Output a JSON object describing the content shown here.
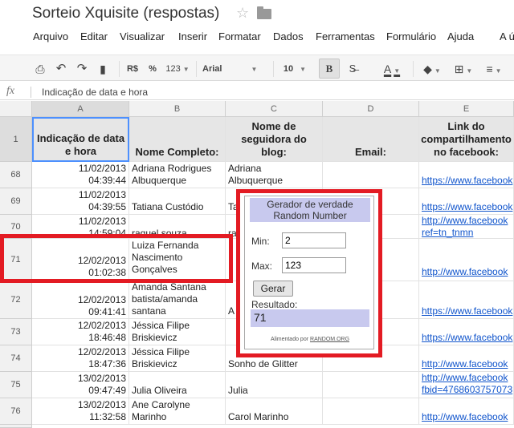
{
  "doc": {
    "title": "Sorteio Xquisite (respostas)"
  },
  "menu": [
    "Arquivo",
    "Editar",
    "Visualizar",
    "Inserir",
    "Formatar",
    "Dados",
    "Ferramentas",
    "Formulário",
    "Ajuda",
    "A ú"
  ],
  "toolbar": {
    "currency": "R$",
    "percent": "%",
    "number_format": "123",
    "font": "Arial",
    "font_size": "10",
    "bold": "B",
    "text_color": "A"
  },
  "formula_bar": {
    "fx": "fx",
    "value": "Indicação de data e hora"
  },
  "columns": [
    "A",
    "B",
    "C",
    "D",
    "E"
  ],
  "header_row": {
    "row_num": "1",
    "a": "Indicação de data e hora",
    "b": "Nome Completo:",
    "c": "Nome de seguidora do blog:",
    "d": "Email:",
    "e": "Link do compartilhamento no facebook:"
  },
  "rows": [
    {
      "num": "68",
      "date": "11/02/2013",
      "time": "04:39:44",
      "name": "Adriana Rodrigues\nAlbuquerque",
      "blog": "Adriana\nAlbuquerque",
      "link": "https://www.facebook"
    },
    {
      "num": "69",
      "date": "11/02/2013",
      "time": "04:39:55",
      "name": "Tatiana Custódio",
      "blog": "Ta",
      "link": "https://www.facebook"
    },
    {
      "num": "70",
      "date": "11/02/2013",
      "time": "14:59:04",
      "name": "raquel souza",
      "blog": "ra",
      "link": "http://www.facebook\nref=tn_tnmn"
    },
    {
      "num": "71",
      "date": "12/02/2013",
      "time": "01:02:38",
      "name": "Luiza Fernanda\nNascimento\nGonçalves",
      "blog": "",
      "link": "http://www.facebook"
    },
    {
      "num": "72",
      "date": "12/02/2013",
      "time": "09:41:41",
      "name": "Amanda Santana\nbatista/amanda\nsantana",
      "blog": "A",
      "link": "https://www.facebook"
    },
    {
      "num": "73",
      "date": "12/02/2013",
      "time": "18:46:48",
      "name": "Jéssica Filipe\nBriskievicz",
      "blog": "",
      "link": "https://www.facebook"
    },
    {
      "num": "74",
      "date": "12/02/2013",
      "time": "18:47:36",
      "name": "Jéssica Filipe\nBriskievicz",
      "blog": "Sonho de Glitter",
      "link": "http://www.facebook"
    },
    {
      "num": "75",
      "date": "13/02/2013",
      "time": "09:47:49",
      "name": "Julia Oliveira",
      "blog": "Julia",
      "link": "http://www.facebook\nfbid=4768603757073"
    },
    {
      "num": "76",
      "date": "13/02/2013",
      "time": "11:32:58",
      "name": "Ane Carolyne\nMarinho",
      "blog": "Carol Marinho",
      "link": "http://www.facebook"
    }
  ],
  "generator": {
    "title": "Gerador de verdade\nRandom Number",
    "min_label": "Min:",
    "min_value": "2",
    "max_label": "Max:",
    "max_value": "123",
    "button": "Gerar",
    "result_label": "Resultado:",
    "result": "71",
    "footer_prefix": "Alimentado por",
    "footer_link": "RANDOM.ORG"
  },
  "colors": {
    "highlight": "#e31b23",
    "generator_accent": "#c8c9ee",
    "link": "#1155cc"
  }
}
